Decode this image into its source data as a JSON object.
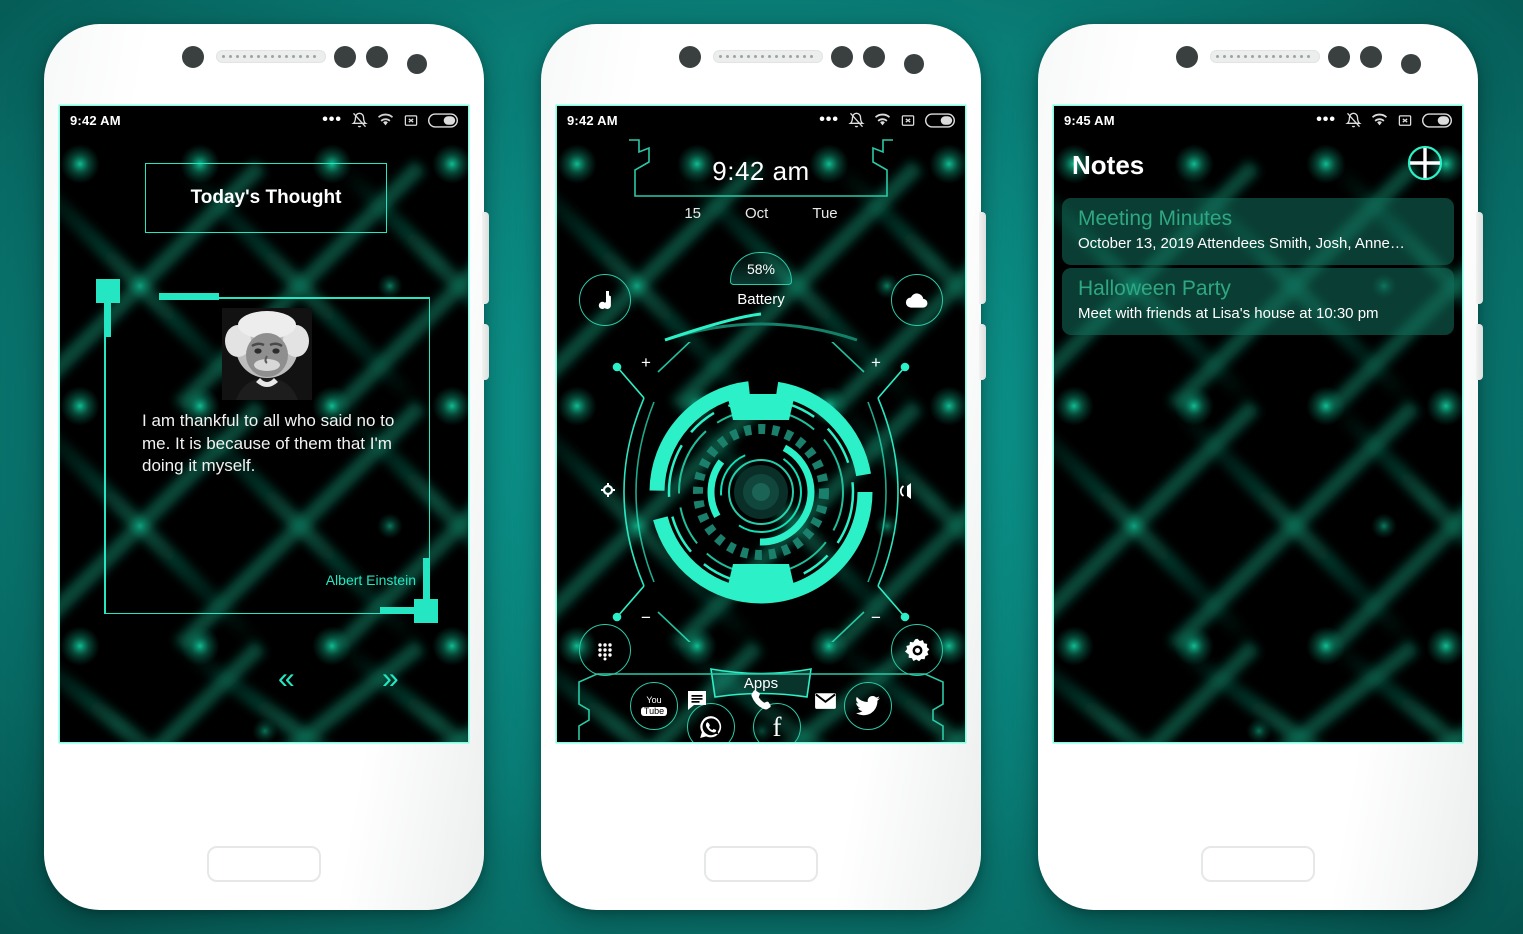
{
  "theme": {
    "accent": "#25e6c2",
    "accent_dim": "#2bc9a8",
    "page_background": "#0a8f87",
    "screen_background": "#000000",
    "note_card": "#12705c"
  },
  "phones": [
    {
      "id": "thought",
      "status_bar": {
        "time": "9:42 AM",
        "icons": [
          "more-dots-icon",
          "bell-muted-icon",
          "wifi-icon",
          "sim-x-icon",
          "battery-icon"
        ]
      },
      "header": {
        "title": "Today's Thought"
      },
      "quote": {
        "portrait_alt": "albert-einstein-portrait",
        "text": "I am thankful to all who said no to me. It is because of them that I'm doing it myself.",
        "author": "Albert Einstein"
      },
      "nav": {
        "prev": "«",
        "next": "»"
      },
      "actions": [
        {
          "name": "share-button",
          "icon": "share-icon"
        },
        {
          "name": "copy-button",
          "icon": "copy-icon"
        }
      ]
    },
    {
      "id": "launcher",
      "status_bar": {
        "time": "9:42 AM",
        "icons": [
          "more-dots-icon",
          "bell-muted-icon",
          "wifi-icon",
          "sim-x-icon",
          "battery-icon"
        ]
      },
      "clock": {
        "time": "9:42 am",
        "day_num": "15",
        "month": "Oct",
        "weekday": "Tue"
      },
      "battery": {
        "percent": "58%",
        "label": "Battery",
        "value": 58
      },
      "side_shortcuts": [
        {
          "name": "music-shortcut",
          "icon": "music-note-icon"
        },
        {
          "name": "weather-shortcut",
          "icon": "cloud-icon"
        },
        {
          "name": "dialpad-shortcut",
          "icon": "dialpad-icon"
        },
        {
          "name": "settings-shortcut",
          "icon": "gear-icon"
        }
      ],
      "hud_controls": [
        {
          "name": "brightness-plus-left",
          "label": "+"
        },
        {
          "name": "brightness-plus-right",
          "label": "+"
        },
        {
          "name": "brightness-minus-left",
          "label": "−"
        },
        {
          "name": "brightness-minus-right",
          "label": "−"
        },
        {
          "name": "brightness-icon",
          "icon": "sun-icon"
        },
        {
          "name": "volume-icon",
          "icon": "speaker-icon"
        }
      ],
      "apps_button": {
        "label": "Apps"
      },
      "app_icons": [
        {
          "name": "youtube-app",
          "label_top": "You",
          "label_bottom": "Tube"
        },
        {
          "name": "whatsapp-app",
          "icon": "whatsapp-icon"
        },
        {
          "name": "facebook-app",
          "icon": "facebook-icon"
        },
        {
          "name": "twitter-app",
          "icon": "twitter-icon"
        }
      ],
      "dock": [
        {
          "name": "messages-dock-icon",
          "icon": "message-icon"
        },
        {
          "name": "phone-dock-icon",
          "icon": "phone-icon"
        },
        {
          "name": "mail-dock-icon",
          "icon": "mail-icon"
        }
      ]
    },
    {
      "id": "notes",
      "status_bar": {
        "time": "9:45 AM",
        "icons": [
          "more-dots-icon",
          "bell-muted-icon",
          "wifi-icon",
          "sim-x-icon",
          "battery-icon"
        ]
      },
      "header": {
        "title": "Notes",
        "add_button": "add-note-button"
      },
      "items": [
        {
          "title": "Meeting Minutes",
          "preview": "October 13, 2019 Attendees Smith, Josh, Anne…"
        },
        {
          "title": "Halloween Party",
          "preview": "Meet with friends at Lisa's house at 10:30 pm"
        }
      ]
    }
  ]
}
